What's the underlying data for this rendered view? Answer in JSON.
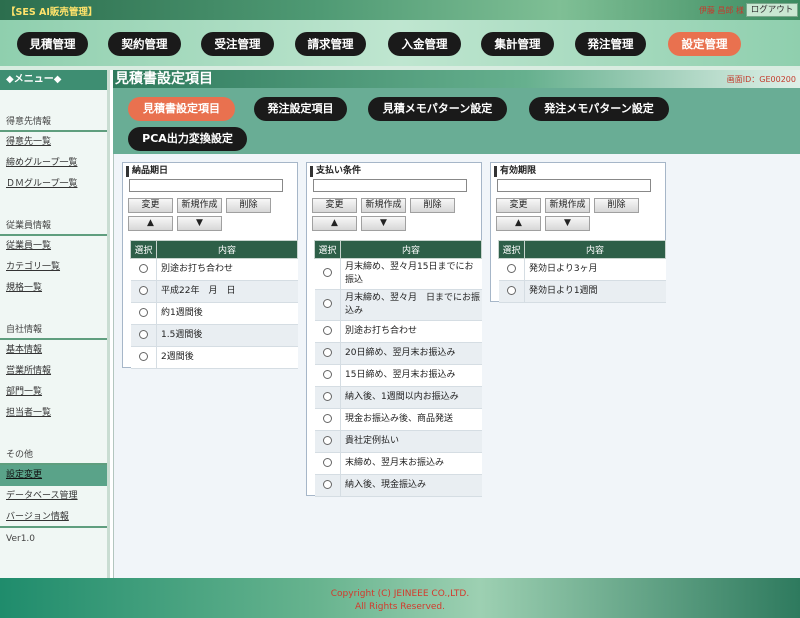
{
  "header": {
    "app_title": "【SES AI販売管理】",
    "user_name": "伊藤 昌郎 様",
    "logout_label": "ログアウト"
  },
  "main_nav": [
    {
      "label": "見積管理",
      "active": false
    },
    {
      "label": "契約管理",
      "active": false
    },
    {
      "label": "受注管理",
      "active": false
    },
    {
      "label": "請求管理",
      "active": false
    },
    {
      "label": "入金管理",
      "active": false
    },
    {
      "label": "集計管理",
      "active": false
    },
    {
      "label": "発注管理",
      "active": false
    },
    {
      "label": "設定管理",
      "active": true
    }
  ],
  "sidebar": {
    "header": "◆メニュー◆",
    "sections": [
      {
        "title": "得意先情報",
        "items": [
          "得意先一覧",
          "締めグループ一覧",
          "ＤＭグループ一覧"
        ]
      },
      {
        "title": "従業員情報",
        "items": [
          "従業員一覧",
          "カテゴリ一覧",
          "規格一覧"
        ]
      },
      {
        "title": "自社情報",
        "items": [
          "基本情報",
          "営業所情報",
          "部門一覧",
          "担当者一覧"
        ]
      },
      {
        "title": "その他",
        "items": [
          "設定変更",
          "データベース管理",
          "バージョン情報"
        ]
      }
    ],
    "current_item": "設定変更",
    "version": "Ver1.0"
  },
  "content": {
    "title": "見積書設定項目",
    "screen_id": "画面ID：GE00200"
  },
  "sub_nav": [
    {
      "label": "見積書設定項目",
      "active": true
    },
    {
      "label": "発注設定項目",
      "active": false
    },
    {
      "label": "見積メモパターン設定",
      "active": false
    },
    {
      "label": "発注メモパターン設定",
      "active": false
    },
    {
      "label": "PCA出力変換設定",
      "active": false
    }
  ],
  "buttons": {
    "change": "変更",
    "new": "新規作成",
    "delete": "削除",
    "up": "▲",
    "down": "▼"
  },
  "panels": [
    {
      "title": "納品期日",
      "col_select": "選択",
      "col_content": "内容",
      "rows": [
        "別途お打ち合わせ",
        "平成22年　月　日",
        "約1週間後",
        "1.5週間後",
        "2週間後"
      ]
    },
    {
      "title": "支払い条件",
      "col_select": "選択",
      "col_content": "内容",
      "rows": [
        "月末締め、翌々月15日までにお振込",
        "月末締め、翌々月　日までにお振込み",
        "別途お打ち合わせ",
        "20日締め、翌月末お振込み",
        "15日締め、翌月末お振込み",
        "納入後、1週間以内お振込み",
        "現金お振込み後、商品発送",
        "貴社定例払い",
        "末締め、翌月末お振込み",
        "納入後、現金振込み"
      ]
    },
    {
      "title": "有効期限",
      "col_select": "選択",
      "col_content": "内容",
      "rows": [
        "発効日より3ヶ月",
        "発効日より1週間"
      ]
    }
  ],
  "footer": {
    "copyright": "Copyright (C) JEINEEE CO.,LTD.",
    "rights": "All Rights Reserved."
  }
}
